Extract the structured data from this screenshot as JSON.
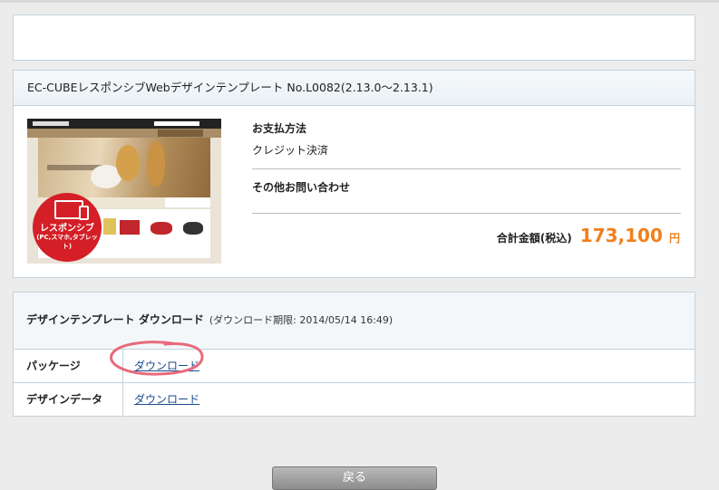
{
  "product": {
    "title": "EC-CUBEレスポンシブWebデザインテンプレート No.L0082(2.13.0〜2.13.1)",
    "badge_title": "レスポンシブ",
    "badge_sub": "(PC,スマホ,タブレット)"
  },
  "payment": {
    "method_label": "お支払方法",
    "method_value": "クレジット決済",
    "inquiry_label": "その他お問い合わせ",
    "total_label": "合計金額(税込)",
    "total_value": "173,100",
    "total_unit": "円"
  },
  "download": {
    "header_title": "デザインテンプレート ダウンロード",
    "header_deadline": "(ダウンロード期限: 2014/05/14 16:49)",
    "rows": [
      {
        "label": "パッケージ",
        "link": "ダウンロード"
      },
      {
        "label": "デザインデータ",
        "link": "ダウンロード"
      }
    ]
  },
  "buttons": {
    "back_label": "戻る"
  },
  "colors": {
    "price": "#f07f1d",
    "badge": "#d41f26",
    "annotation": "#e86a7c",
    "link": "#1a4a8e"
  }
}
